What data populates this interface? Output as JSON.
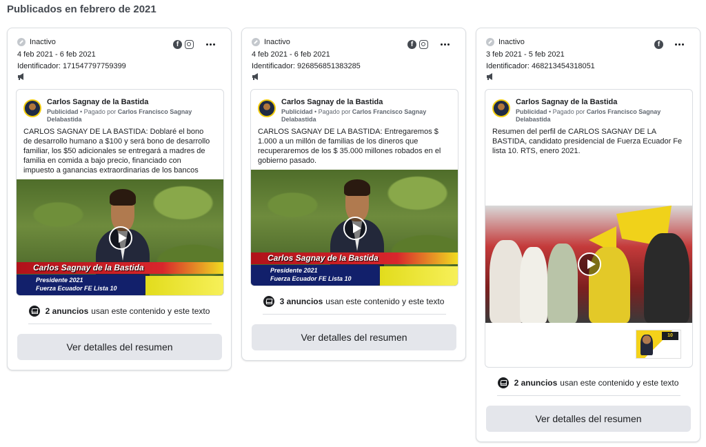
{
  "page": {
    "section_title": "Publicados en febrero de 2021"
  },
  "cards": [
    {
      "status": "Inactivo",
      "dates": "4 feb 2021 - 6 feb 2021",
      "identifier": "Identificador: 171547797759399",
      "platforms": [
        "facebook-icon",
        "instagram-icon"
      ],
      "advertiser": "Carlos Sagnay de la Bastida",
      "ad_type": "Publicidad",
      "paid_by_prefix": " • Pagado por ",
      "paid_by": "Carlos Francisco Sagnay Delabastida",
      "body": "CARLOS SAGNAY DE LA BASTIDA: Doblaré el bono de desarrollo humano a $100 y será bono de desarrollo familiar, los $50 adicionales se entregará a madres de familia en comida a bajo precio, financiado con impuesto a ganancias extraordinarias de los bancos",
      "video_overlay": {
        "name": "Carlos Sagnay de la Bastida",
        "line1": "Presidente 2021",
        "line2": "Fuerza Ecuador FE Lista 10"
      },
      "uses_count": "2 anuncios",
      "uses_text": "usan este contenido y este texto",
      "details_button": "Ver detalles del resumen"
    },
    {
      "status": "Inactivo",
      "dates": "4 feb 2021 - 6 feb 2021",
      "identifier": "Identificador: 926856851383285",
      "platforms": [
        "facebook-icon",
        "instagram-icon"
      ],
      "advertiser": "Carlos Sagnay de la Bastida",
      "ad_type": "Publicidad",
      "paid_by_prefix": " • Pagado por ",
      "paid_by": "Carlos Francisco Sagnay Delabastida",
      "body": "CARLOS SAGNAY DE LA BASTIDA: Entregaremos $ 1.000 a un millón de familias de los dineros que recuperaremos de los $ 35.000 millones robados en el gobierno pasado.",
      "video_overlay": {
        "name": "Carlos Sagnay de la Bastida",
        "line1": "Presidente 2021",
        "line2": "Fuerza Ecuador FE Lista 10"
      },
      "uses_count": "3 anuncios",
      "uses_text": "usan este contenido y este texto",
      "details_button": "Ver detalles del resumen"
    },
    {
      "status": "Inactivo",
      "dates": "3 feb 2021 - 5 feb 2021",
      "identifier": "Identificador: 468213454318051",
      "platforms": [
        "facebook-icon"
      ],
      "advertiser": "Carlos Sagnay de la Bastida",
      "ad_type": "Publicidad",
      "paid_by_prefix": " • Pagado por ",
      "paid_by": "Carlos Francisco Sagnay Delabastida",
      "body": "Resumen del perfil de CARLOS SAGNAY DE LA BASTIDA, candidato presidencial de Fuerza Ecuador Fe lista 10. RTS, enero 2021.",
      "uses_count": "2 anuncios",
      "uses_text": "usan este contenido y este texto",
      "details_button": "Ver detalles del resumen"
    }
  ]
}
